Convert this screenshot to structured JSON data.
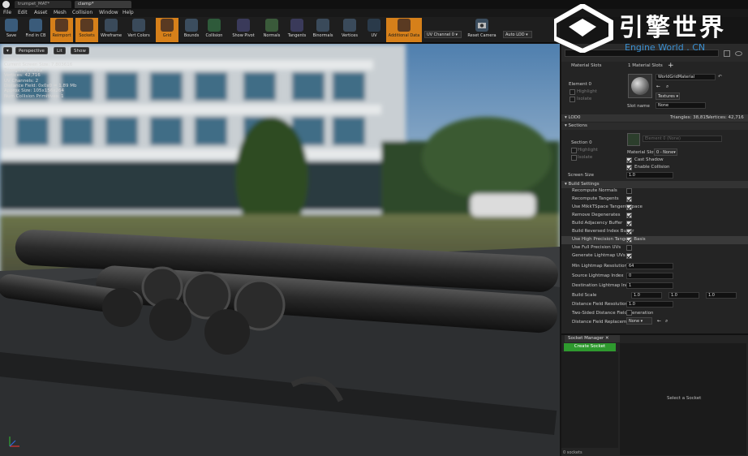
{
  "window": {
    "tabs": [
      "trumpet_MAT*",
      "clamp*"
    ]
  },
  "menu": [
    "File",
    "Edit",
    "Asset",
    "Mesh",
    "Collision",
    "Window",
    "Help"
  ],
  "toolbar": {
    "buttons": [
      {
        "label": "Save",
        "icon": "save-icon",
        "active": false
      },
      {
        "label": "Find in CB",
        "icon": "find-in-cb-icon",
        "active": false
      },
      {
        "label": "Reimport",
        "icon": "reimport-icon",
        "active": true
      },
      {
        "label": "Sockets",
        "icon": "sockets-icon",
        "active": true
      },
      {
        "label": "Wireframe",
        "icon": "wireframe-icon",
        "active": false
      },
      {
        "label": "Vert Colors",
        "icon": "vert-colors-icon",
        "active": false
      },
      {
        "label": "Grid",
        "icon": "grid-icon",
        "active": true
      },
      {
        "label": "Bounds",
        "icon": "bounds-icon",
        "active": false
      },
      {
        "label": "Collision",
        "icon": "collision-icon",
        "active": false
      },
      {
        "label": "Show Pivot",
        "icon": "pivot-icon",
        "active": false
      },
      {
        "label": "Normals",
        "icon": "normals-icon",
        "active": false
      },
      {
        "label": "Tangents",
        "icon": "tangents-icon",
        "active": false
      },
      {
        "label": "Binormals",
        "icon": "binormals-icon",
        "active": false
      },
      {
        "label": "Vertices",
        "icon": "vertices-icon",
        "active": false
      },
      {
        "label": "UV",
        "icon": "uv-icon",
        "active": false
      },
      {
        "label": "Additional Data",
        "icon": "additional-data-icon",
        "active": true
      }
    ],
    "uv_channel": "UV Channel 0",
    "reset_camera": "Reset Camera",
    "lod_select": "Auto LOD"
  },
  "viewport": {
    "perspective": "Perspective",
    "lit": "Lit",
    "show": "Show",
    "stats": [
      "LOD: 0",
      "Current Screen Size: 7.803616",
      "Triangles: 38,815",
      "Vertices: 42,716",
      "UV Channels: 2",
      "Distance Field: 0x0x0 = 1.89 Mb",
      "Approx Size: 105x156x264",
      "Num Collision Primitives: 1"
    ]
  },
  "details": {
    "col_material_slots": "Material Slots",
    "col_material_count": "1 Material Slots",
    "slot_name": "Element 0",
    "highlight": "Highlight",
    "isolate": "Isolate",
    "material_name": "WorldGridMaterial",
    "textures_btn": "Textures",
    "slot_label": "Slot name",
    "slot_value": "None",
    "lod_header": "LOD0",
    "lod_tri": "Triangles: 38,815",
    "lod_vert": "Vertices: 42,716",
    "sections_header": "Sections",
    "section_name": "Section 0",
    "section_material": "Element 0 (None)",
    "material_slot_label": "Material Slot",
    "material_slot_value": "0 - None",
    "cast_shadow": "Cast Shadow",
    "enable_collision": "Enable Collision",
    "screen_size_label": "Screen Size",
    "screen_size_value": "1.0",
    "build_header": "Build Settings",
    "settings": [
      {
        "label": "Recompute Normals",
        "checked": false
      },
      {
        "label": "Recompute Tangents",
        "checked": true
      },
      {
        "label": "Use MikkTSpace Tangent Space",
        "checked": true
      },
      {
        "label": "Remove Degenerates",
        "checked": true
      },
      {
        "label": "Build Adjacency Buffer",
        "checked": true
      },
      {
        "label": "Build Reversed Index Buffer",
        "checked": true
      },
      {
        "label": "Use High Precision Tangent Basis",
        "checked": true
      },
      {
        "label": "Use Full Precision UVs",
        "checked": false
      },
      {
        "label": "Generate Lightmap UVs",
        "checked": true
      }
    ],
    "min_lightmap_label": "Min Lightmap Resolution",
    "min_lightmap_value": "64",
    "src_lightmap_label": "Source Lightmap Index",
    "src_lightmap_value": "0",
    "dst_lightmap_label": "Destination Lightmap Index",
    "dst_lightmap_value": "1",
    "build_scale_label": "Build Scale",
    "build_scale_x": "1.0",
    "build_scale_y": "1.0",
    "build_scale_z": "1.0",
    "dfres_label": "Distance Field Resolution Scale",
    "dfres_value": "1.0",
    "twosided_label": "Two-Sided Distance Field Generation",
    "dfrepl_label": "Distance Field Replacement Mesh",
    "dfrepl_value": "None"
  },
  "socket_panel": {
    "tab": "Socket Manager",
    "create_socket": "Create Socket",
    "select_socket": "Select a Socket",
    "sockets_count": "0 sockets"
  },
  "logo": {
    "chinese": "引擎世界",
    "latin": "Engine World . CN"
  }
}
